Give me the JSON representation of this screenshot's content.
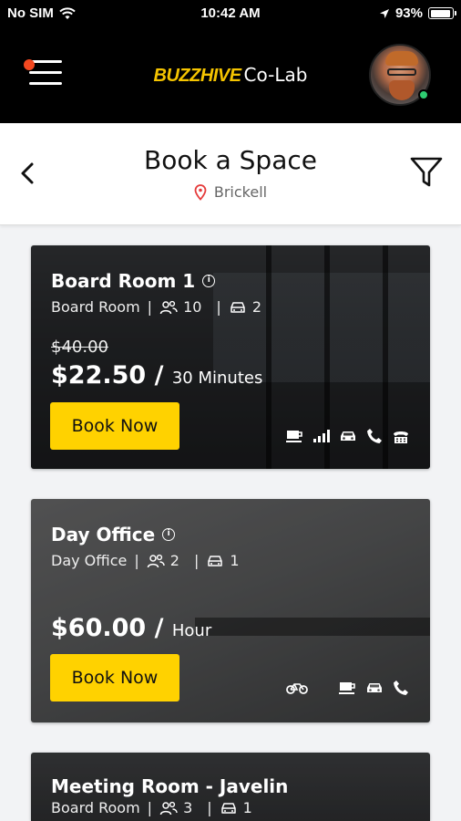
{
  "status_bar": {
    "carrier": "No SIM",
    "time": "10:42 AM",
    "battery": "93%",
    "battery_level": 0.93
  },
  "header": {
    "logo_brand": "BUZZHIVE",
    "logo_suffix": "Co-Lab"
  },
  "title_bar": {
    "title": "Book a Space",
    "location": "Brickell"
  },
  "cards": [
    {
      "name": "Board Room 1",
      "type": "Board Room",
      "capacity": "10",
      "parking": "2",
      "original_price": "$40.00",
      "price": "$22.50 /",
      "unit": "30 Minutes",
      "button": "Book Now",
      "amenities": [
        "coffee-icon",
        "wifi-signal-icon",
        "car-icon",
        "phone-icon",
        "printer-icon"
      ]
    },
    {
      "name": "Day Office",
      "type": "Day Office",
      "capacity": "2",
      "parking": "1",
      "price": "$60.00 /",
      "unit": "Hour",
      "button": "Book Now",
      "amenities": [
        "bike-icon",
        "coffee-icon",
        "car-icon",
        "phone-icon"
      ]
    },
    {
      "name": "Meeting Room - Javelin",
      "type": "Board Room",
      "capacity": "3",
      "parking": "1"
    }
  ],
  "colors": {
    "accent": "#ffd200",
    "header_bg": "#000000",
    "notification_dot": "#f44820",
    "online": "#2ecc71"
  }
}
